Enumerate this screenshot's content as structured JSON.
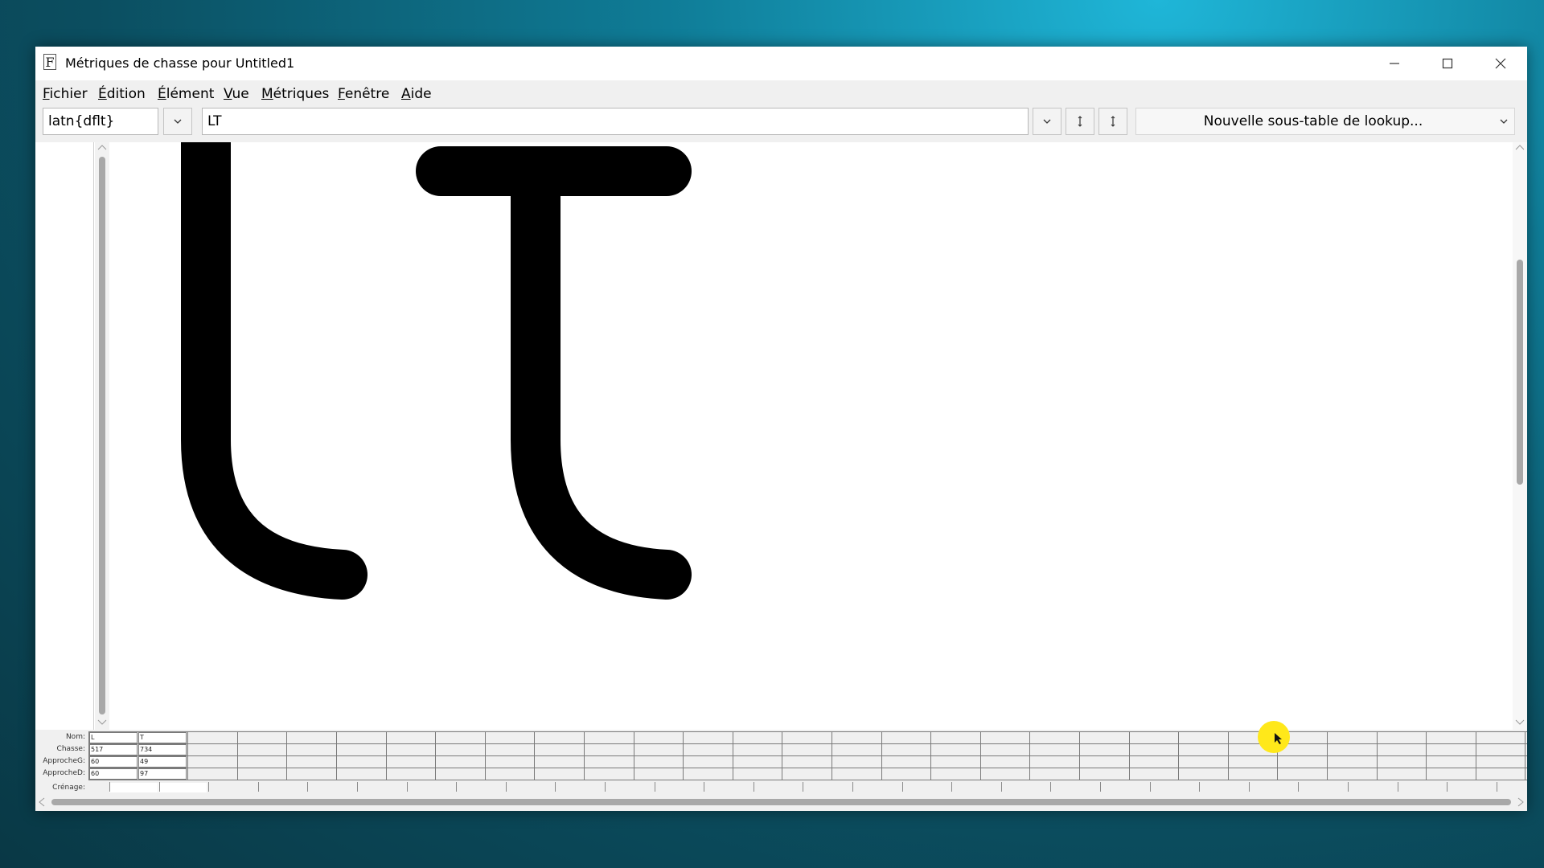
{
  "window": {
    "title": "Métriques de chasse pour Untitled1",
    "app_icon_letter": "F",
    "controls": {
      "minimize": "–",
      "maximize": "□",
      "close": "✕"
    }
  },
  "menu": [
    {
      "label": "Fichier",
      "accel": "F",
      "rest": "ichier"
    },
    {
      "label": "Édition",
      "accel": "É",
      "rest": "dition"
    },
    {
      "label": "Élément",
      "accel": "É",
      "rest": "lément"
    },
    {
      "label": "Vue",
      "accel": "V",
      "rest": "ue"
    },
    {
      "label": "Métriques",
      "accel": "M",
      "rest": "étriques"
    },
    {
      "label": "Fenêtre",
      "accel": "F",
      "rest": "enêtre"
    },
    {
      "label": "Aide",
      "accel": "A",
      "rest": "ide"
    }
  ],
  "toolbar": {
    "script_value": "latn{dflt}",
    "text_value": "LT",
    "lookup_label": "Nouvelle sous-table de lookup...",
    "dropdown_glyph": "⌄",
    "updown_glyph": "⁝"
  },
  "glyphs": [
    "L",
    "T"
  ],
  "metrics": {
    "labels": {
      "name": "Nom:",
      "advance": "Chasse:",
      "lsb": "ApprocheG:",
      "rsb": "ApprocheD:",
      "kern": "Crénage:"
    },
    "columns": [
      {
        "name": "L",
        "advance": "517",
        "lsb": "60",
        "rsb": "60"
      },
      {
        "name": "T",
        "advance": "734",
        "lsb": "49",
        "rsb": "97"
      }
    ]
  }
}
